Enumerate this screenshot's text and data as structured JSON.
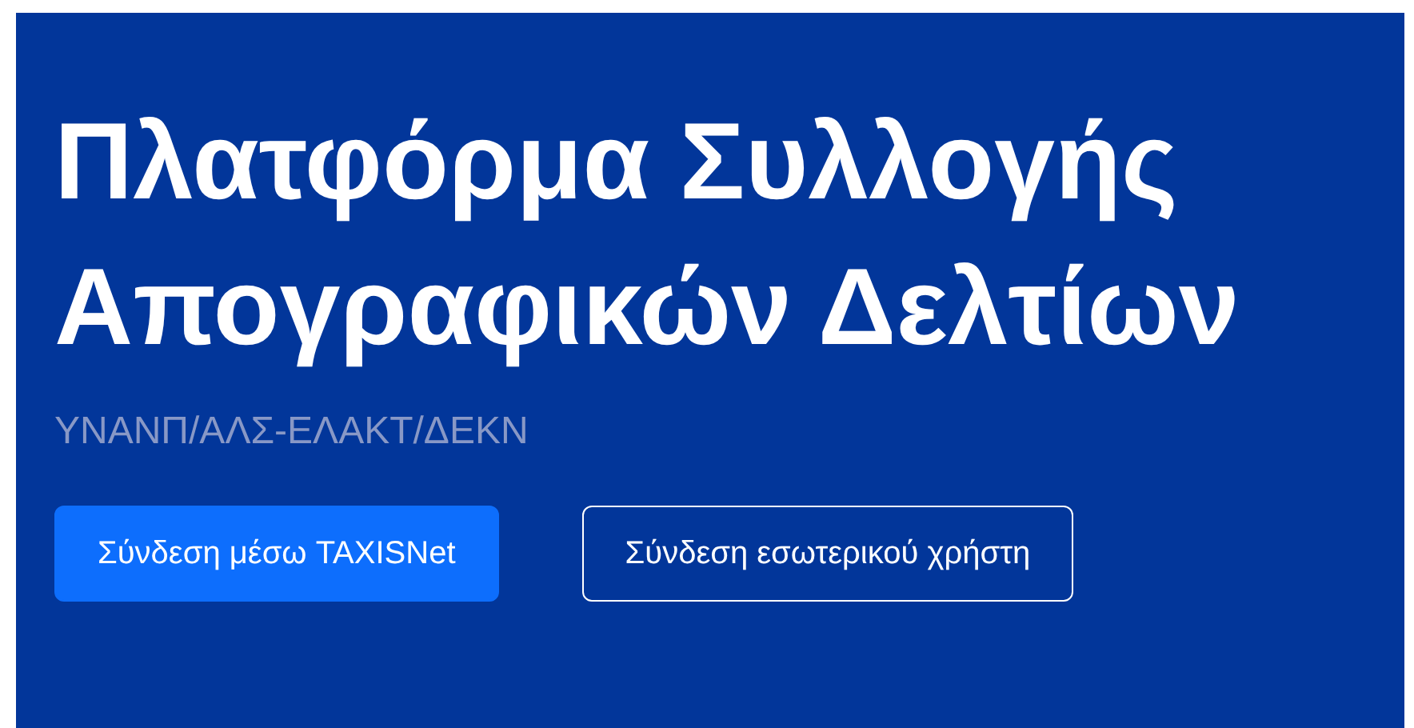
{
  "hero": {
    "title": "Πλατφόρμα Συλλογής Απογραφικών Δελτίων",
    "subtitle": "ΥΝΑΝΠ/ΑΛΣ-ΕΛΑΚΤ/ΔΕΚΝ",
    "buttons": [
      {
        "label": "Σύνδεση μέσω TAXISNet",
        "kind": "primary"
      },
      {
        "label": "Σύνδεση εσωτερικού χρήστη",
        "kind": "outline"
      }
    ]
  }
}
